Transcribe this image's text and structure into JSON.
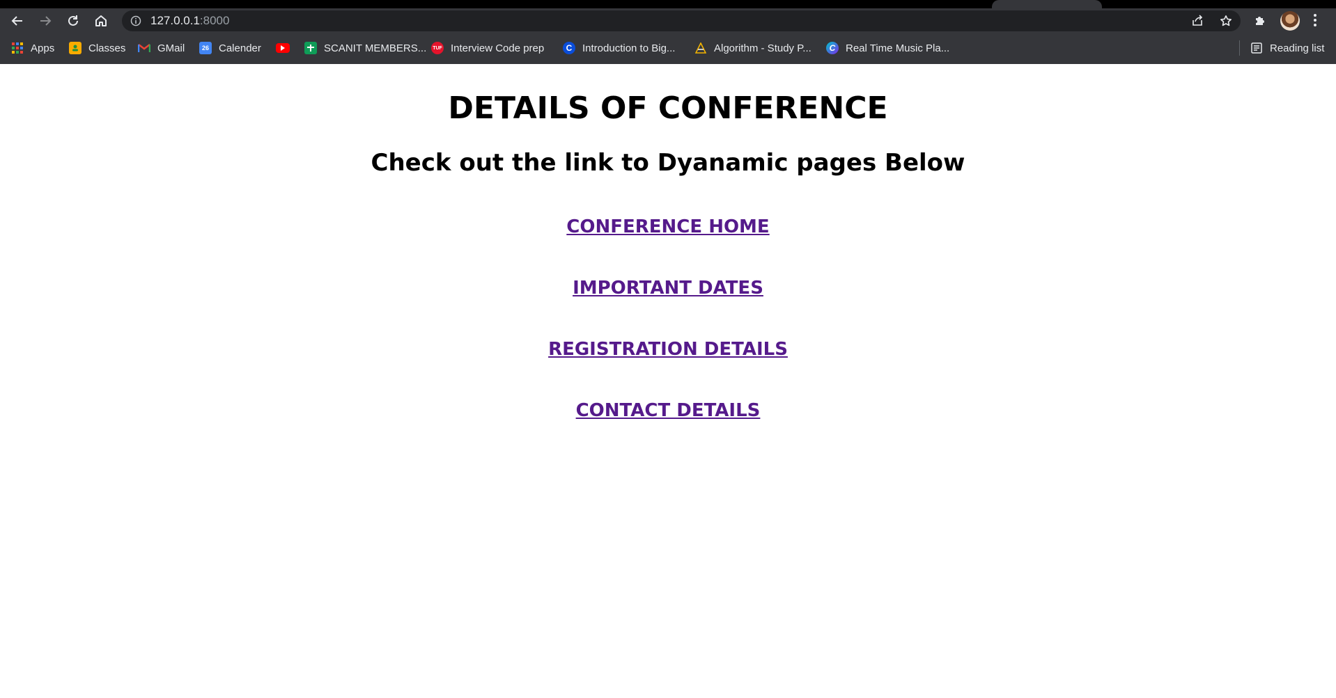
{
  "browser": {
    "url_host": "127.0.0.1",
    "url_port": ":8000",
    "bookmarks": [
      {
        "label": "Apps",
        "icon": "apps-grid-icon"
      },
      {
        "label": "Classes",
        "icon": "classroom-icon"
      },
      {
        "label": "GMail",
        "icon": "gmail-icon"
      },
      {
        "label": "Calender",
        "icon": "calendar-icon"
      },
      {
        "label": "",
        "icon": "youtube-icon"
      },
      {
        "label": "SCANIT MEMBERS...",
        "icon": "sheets-icon"
      },
      {
        "label": "Interview Code prep",
        "icon": "tuf-icon"
      },
      {
        "label": "Introduction to Big...",
        "icon": "c-logo-icon"
      },
      {
        "label": "Algorithm - Study P...",
        "icon": "algorithm-icon"
      },
      {
        "label": "Real Time Music Pla...",
        "icon": "canva-icon"
      }
    ],
    "reading_list_label": "Reading list",
    "calendar_day": "26",
    "tuf_text": "TUF",
    "c_letter": "C",
    "canva_letter": "C"
  },
  "page": {
    "title": "DETAILS OF CONFERENCE",
    "subtitle": "Check out the link to Dyanamic pages Below",
    "links": [
      {
        "label": "CONFERENCE HOME"
      },
      {
        "label": "IMPORTANT DATES"
      },
      {
        "label": "REGISTRATION DETAILS"
      },
      {
        "label": "CONTACT DETAILS"
      }
    ]
  },
  "colors": {
    "chrome_toolbar": "#35363a",
    "omnibox": "#202124",
    "visited_link": "#551a8b"
  }
}
